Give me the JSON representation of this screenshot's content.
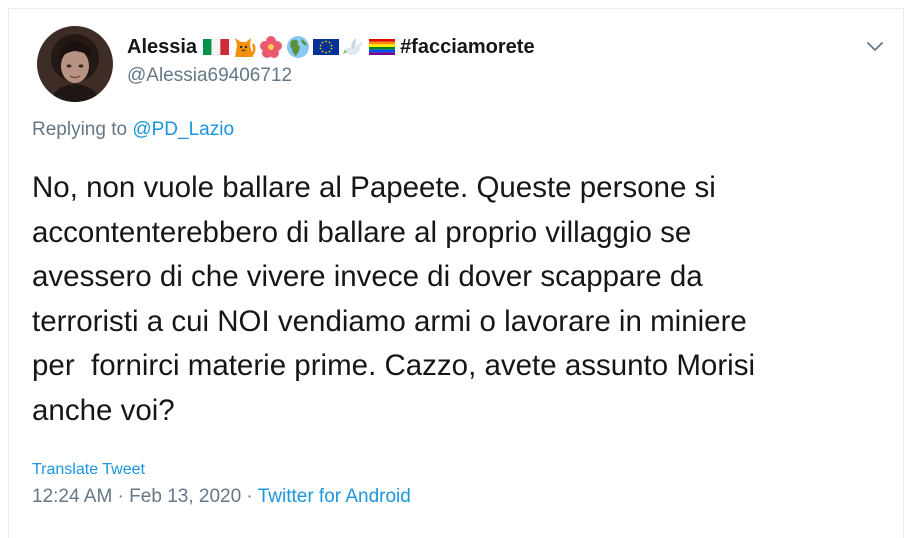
{
  "user": {
    "display_name": "Alessia",
    "name_emojis": [
      "italy-flag",
      "cat",
      "hibiscus",
      "globe-europe-africa",
      "eu-flag",
      "dove",
      "rainbow-flag"
    ],
    "name_hashtag": "#facciamorete",
    "handle": "@Alessia69406712"
  },
  "reply": {
    "prefix": "Replying to ",
    "mention": "@PD_Lazio"
  },
  "tweet": {
    "text": "No, non vuole ballare al Papeete. Queste persone si\naccontenterebbero di ballare al proprio villaggio se\navessero di che vivere invece di dover scappare da\nterroristi a cui NOI vendiamo armi o lavorare in miniere\nper  fornirci materie prime. Cazzo, avete assunto Morisi\nanche voi?",
    "translate_label": "Translate Tweet",
    "time": "12:24 AM",
    "separator1": " · ",
    "date": "Feb 13, 2020",
    "separator2": " · ",
    "source": "Twitter for Android"
  },
  "colors": {
    "text": "#14171a",
    "secondary": "#657786",
    "link": "#1b95e0",
    "border": "#e6ecf0"
  },
  "icons": {
    "menu": "chevron-down-icon"
  }
}
